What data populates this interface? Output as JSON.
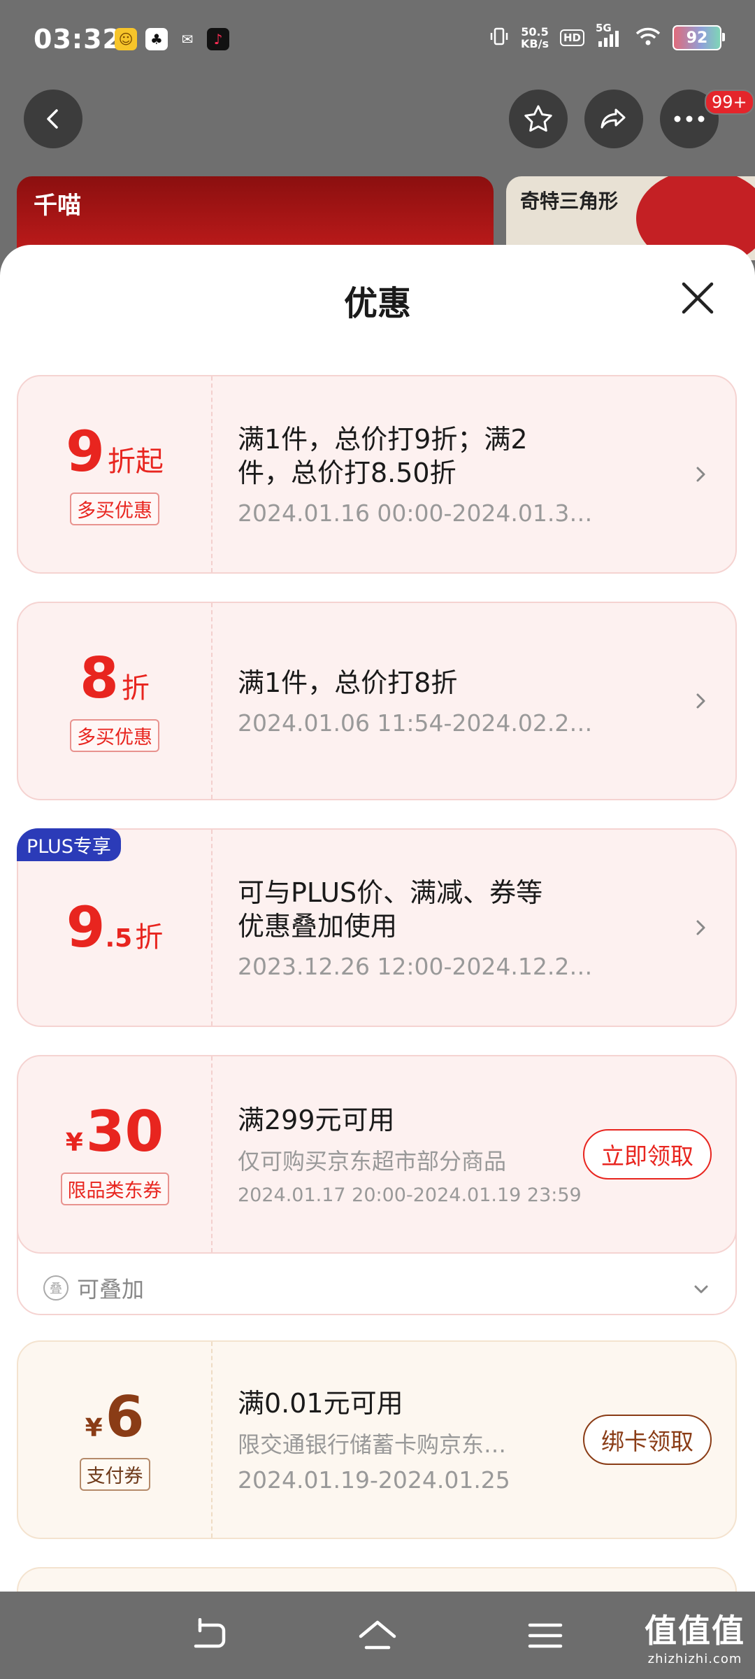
{
  "status_bar": {
    "time": "03:32",
    "net_speed": "50.5",
    "net_unit": "KB/s",
    "hd": "HD",
    "signal": "5G",
    "battery": "92"
  },
  "nav": {
    "more_badge": "99+"
  },
  "banner": {
    "left_logo": "千喵",
    "right_title": "奇特三角形"
  },
  "sheet": {
    "title": "优惠"
  },
  "cards": [
    {
      "num": "9",
      "suffix": "折起",
      "tag": "多买优惠",
      "line1": "满1件，总价打9折；满2",
      "line2": "件，总价打8.50折",
      "date": "2024.01.16 00:00-2024.01.3…"
    },
    {
      "num": "8",
      "suffix": "折",
      "tag": "多买优惠",
      "line1": "满1件，总价打8折",
      "date": "2024.01.06 11:54-2024.02.2…"
    },
    {
      "badge": "PLUS专享",
      "num": "9",
      "decimal": ".5",
      "suffix": "折",
      "line1": "可与PLUS价、满减、券等",
      "line2": "优惠叠加使用",
      "date": "2023.12.26 12:00-2024.12.2…"
    },
    {
      "currency": "¥",
      "num": "30",
      "tag": "限品类东券",
      "line1": "满299元可用",
      "desc": "仅可购买京东超市部分商品",
      "date": "2024.01.17 20:00-2024.01.19 23:59",
      "action": "立即领取",
      "stack_label": "可叠加",
      "stack_icon_text": "叠"
    },
    {
      "currency": "¥",
      "num": "6",
      "tag": "支付券",
      "line1": "满0.01元可用",
      "desc": "限交通银行储蓄卡购京东…",
      "date": "2024.01.19-2024.01.25",
      "action": "绑卡领取"
    }
  ],
  "watermark": {
    "text": "值值值",
    "domain": "zhizhizhi.com"
  }
}
